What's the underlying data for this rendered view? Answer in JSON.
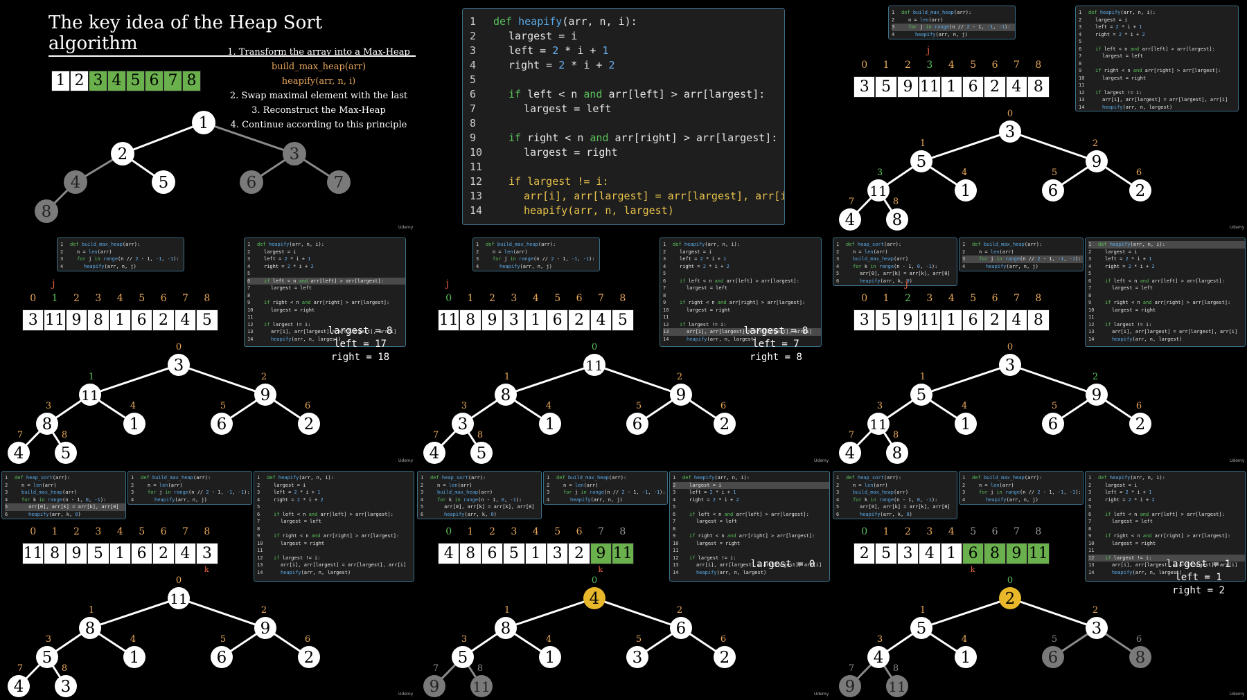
{
  "title": "The key idea of the Heap Sort algorithm",
  "steps": [
    "1. Transform the array into a Max-Heap",
    "build_max_heap(arr)",
    "heapify(arr, n, i)",
    "2. Swap maximal element with the last",
    "3. Reconstruct the Max-Heap",
    "4. Continue according to this principle"
  ],
  "intro_array": [
    "1",
    "2",
    "3",
    "4",
    "5",
    "6",
    "7",
    "8"
  ],
  "brand": "Udemy",
  "heapify_code": [
    "def heapify(arr, n, i):",
    "largest = i",
    "left = 2 * i + 1",
    "right = 2 * i + 2",
    "",
    "if left < n and arr[left] > arr[largest]:",
    "largest = left",
    "",
    "if right < n and arr[right] > arr[largest]:",
    "largest = right",
    "",
    "if largest != i:",
    "arr[i], arr[largest] = arr[largest], arr[i]",
    "heapify(arr, n, largest)"
  ],
  "build_code": [
    "def build_max_heap(arr):",
    "n = len(arr)",
    "for j in range(n // 2 - 1, -1, -1):",
    "heapify(arr, n, j)"
  ],
  "sort_code": [
    "def heap_sort(arr):",
    "n = len(arr)",
    "build_max_heap(arr)",
    "for k in range(n - 1, 0, -1):",
    "arr[0], arr[k] = arr[k], arr[0]",
    "heapify(arr, k, 0)"
  ],
  "indices": [
    "0",
    "1",
    "2",
    "3",
    "4",
    "5",
    "6",
    "7",
    "8"
  ],
  "panels": [
    {
      "array": [
        "3",
        "5",
        "9",
        "11",
        "1",
        "6",
        "2",
        "4",
        "8"
      ],
      "green": [],
      "j": 3,
      "k": null,
      "nodes": [
        "3",
        "5",
        "9",
        "11",
        "1",
        "6",
        "2",
        "4",
        "8"
      ],
      "status": []
    },
    {
      "array": [
        "3",
        "11",
        "9",
        "8",
        "1",
        "6",
        "2",
        "4",
        "5"
      ],
      "green": [],
      "j": 1,
      "k": null,
      "nodes": [
        "3",
        "11",
        "9",
        "8",
        "1",
        "6",
        "2",
        "4",
        "5"
      ],
      "status": [
        "largest = 8",
        "left = 17",
        "right = 18"
      ]
    },
    {
      "array": [
        "11",
        "8",
        "9",
        "3",
        "1",
        "6",
        "2",
        "4",
        "5"
      ],
      "green": [],
      "j": 0,
      "k": null,
      "nodes": [
        "11",
        "8",
        "9",
        "3",
        "1",
        "6",
        "2",
        "4",
        "5"
      ],
      "status": [
        "largest = 8",
        "left = 7",
        "right = 8"
      ]
    },
    {
      "array": [
        "3",
        "5",
        "9",
        "11",
        "1",
        "6",
        "2",
        "4",
        "8"
      ],
      "green": [],
      "j": 2,
      "k": null,
      "nodes": [
        "3",
        "5",
        "9",
        "11",
        "1",
        "6",
        "2",
        "4",
        "8"
      ],
      "status": []
    },
    {
      "array": [
        "11",
        "8",
        "9",
        "5",
        "1",
        "6",
        "2",
        "4",
        "3"
      ],
      "green": [],
      "j": null,
      "k": 8,
      "nodes": [
        "11",
        "8",
        "9",
        "5",
        "1",
        "6",
        "2",
        "4",
        "3"
      ],
      "status": []
    },
    {
      "array": [
        "4",
        "8",
        "6",
        "5",
        "1",
        "3",
        "2",
        "9",
        "11"
      ],
      "green": [
        7,
        8
      ],
      "j": null,
      "k": 7,
      "nodes": [
        "4",
        "8",
        "6",
        "5",
        "1",
        "3",
        "2",
        "9",
        "11"
      ],
      "status": [
        "largest = 0"
      ]
    },
    {
      "array": [
        "2",
        "5",
        "3",
        "4",
        "1",
        "6",
        "8",
        "9",
        "11"
      ],
      "green": [
        5,
        6,
        7,
        8
      ],
      "j": null,
      "k": 5,
      "nodes": [
        "2",
        "5",
        "3",
        "4",
        "1",
        "6",
        "8",
        "9",
        "11"
      ],
      "status": [
        "largest = 1",
        "left = 1",
        "right = 2"
      ]
    }
  ],
  "j_label": "j",
  "k_label": "k",
  "colors": {
    "green": "#6ab04c",
    "accent": "#e8a85a",
    "gold": "#e8b82a",
    "gray": "#7a7a7a",
    "panel_border": "#3a6f88"
  }
}
